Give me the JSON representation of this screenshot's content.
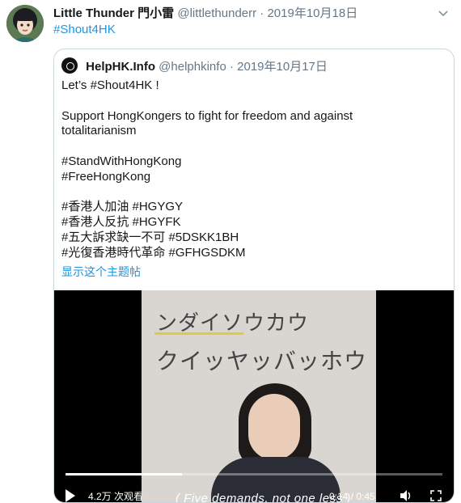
{
  "tweet": {
    "author_name": "Little Thunder 門小雷",
    "handle": "@littlethunderr",
    "separator": "·",
    "date": "2019年10月18日",
    "text": "#Shout4HK",
    "menu_icon": "chevron-down-icon"
  },
  "quoted": {
    "author_name": "HelpHK.Info",
    "handle": "@helphkinfo",
    "separator": "·",
    "date": "2019年10月17日",
    "lines": [
      "Let’s #Shout4HK !",
      "",
      "Support HongKongers to fight for freedom and against",
      "totalitarianism",
      "",
      "#StandWithHongKong",
      "#FreeHongKong",
      "",
      "#香港人加油 #HGYGY",
      "#香港人反抗 #HGYFK",
      "#五大訴求缺一不可 #5DSKK1BH",
      "#光復香港時代革命 #GFHGSDKM"
    ],
    "show_thread": "显示这个主题帖"
  },
  "video": {
    "caption_line1": "ンダイソウカウ",
    "caption_line2": "クイッヤッバッホウ",
    "subtitle": "( Five demands, not one less )",
    "views": "4.2万 次观看",
    "time": "0:14 / 0:45",
    "progress": 0.31,
    "icons": {
      "play": "play-icon",
      "volume": "volume-icon",
      "fullscreen": "fullscreen-icon"
    }
  }
}
